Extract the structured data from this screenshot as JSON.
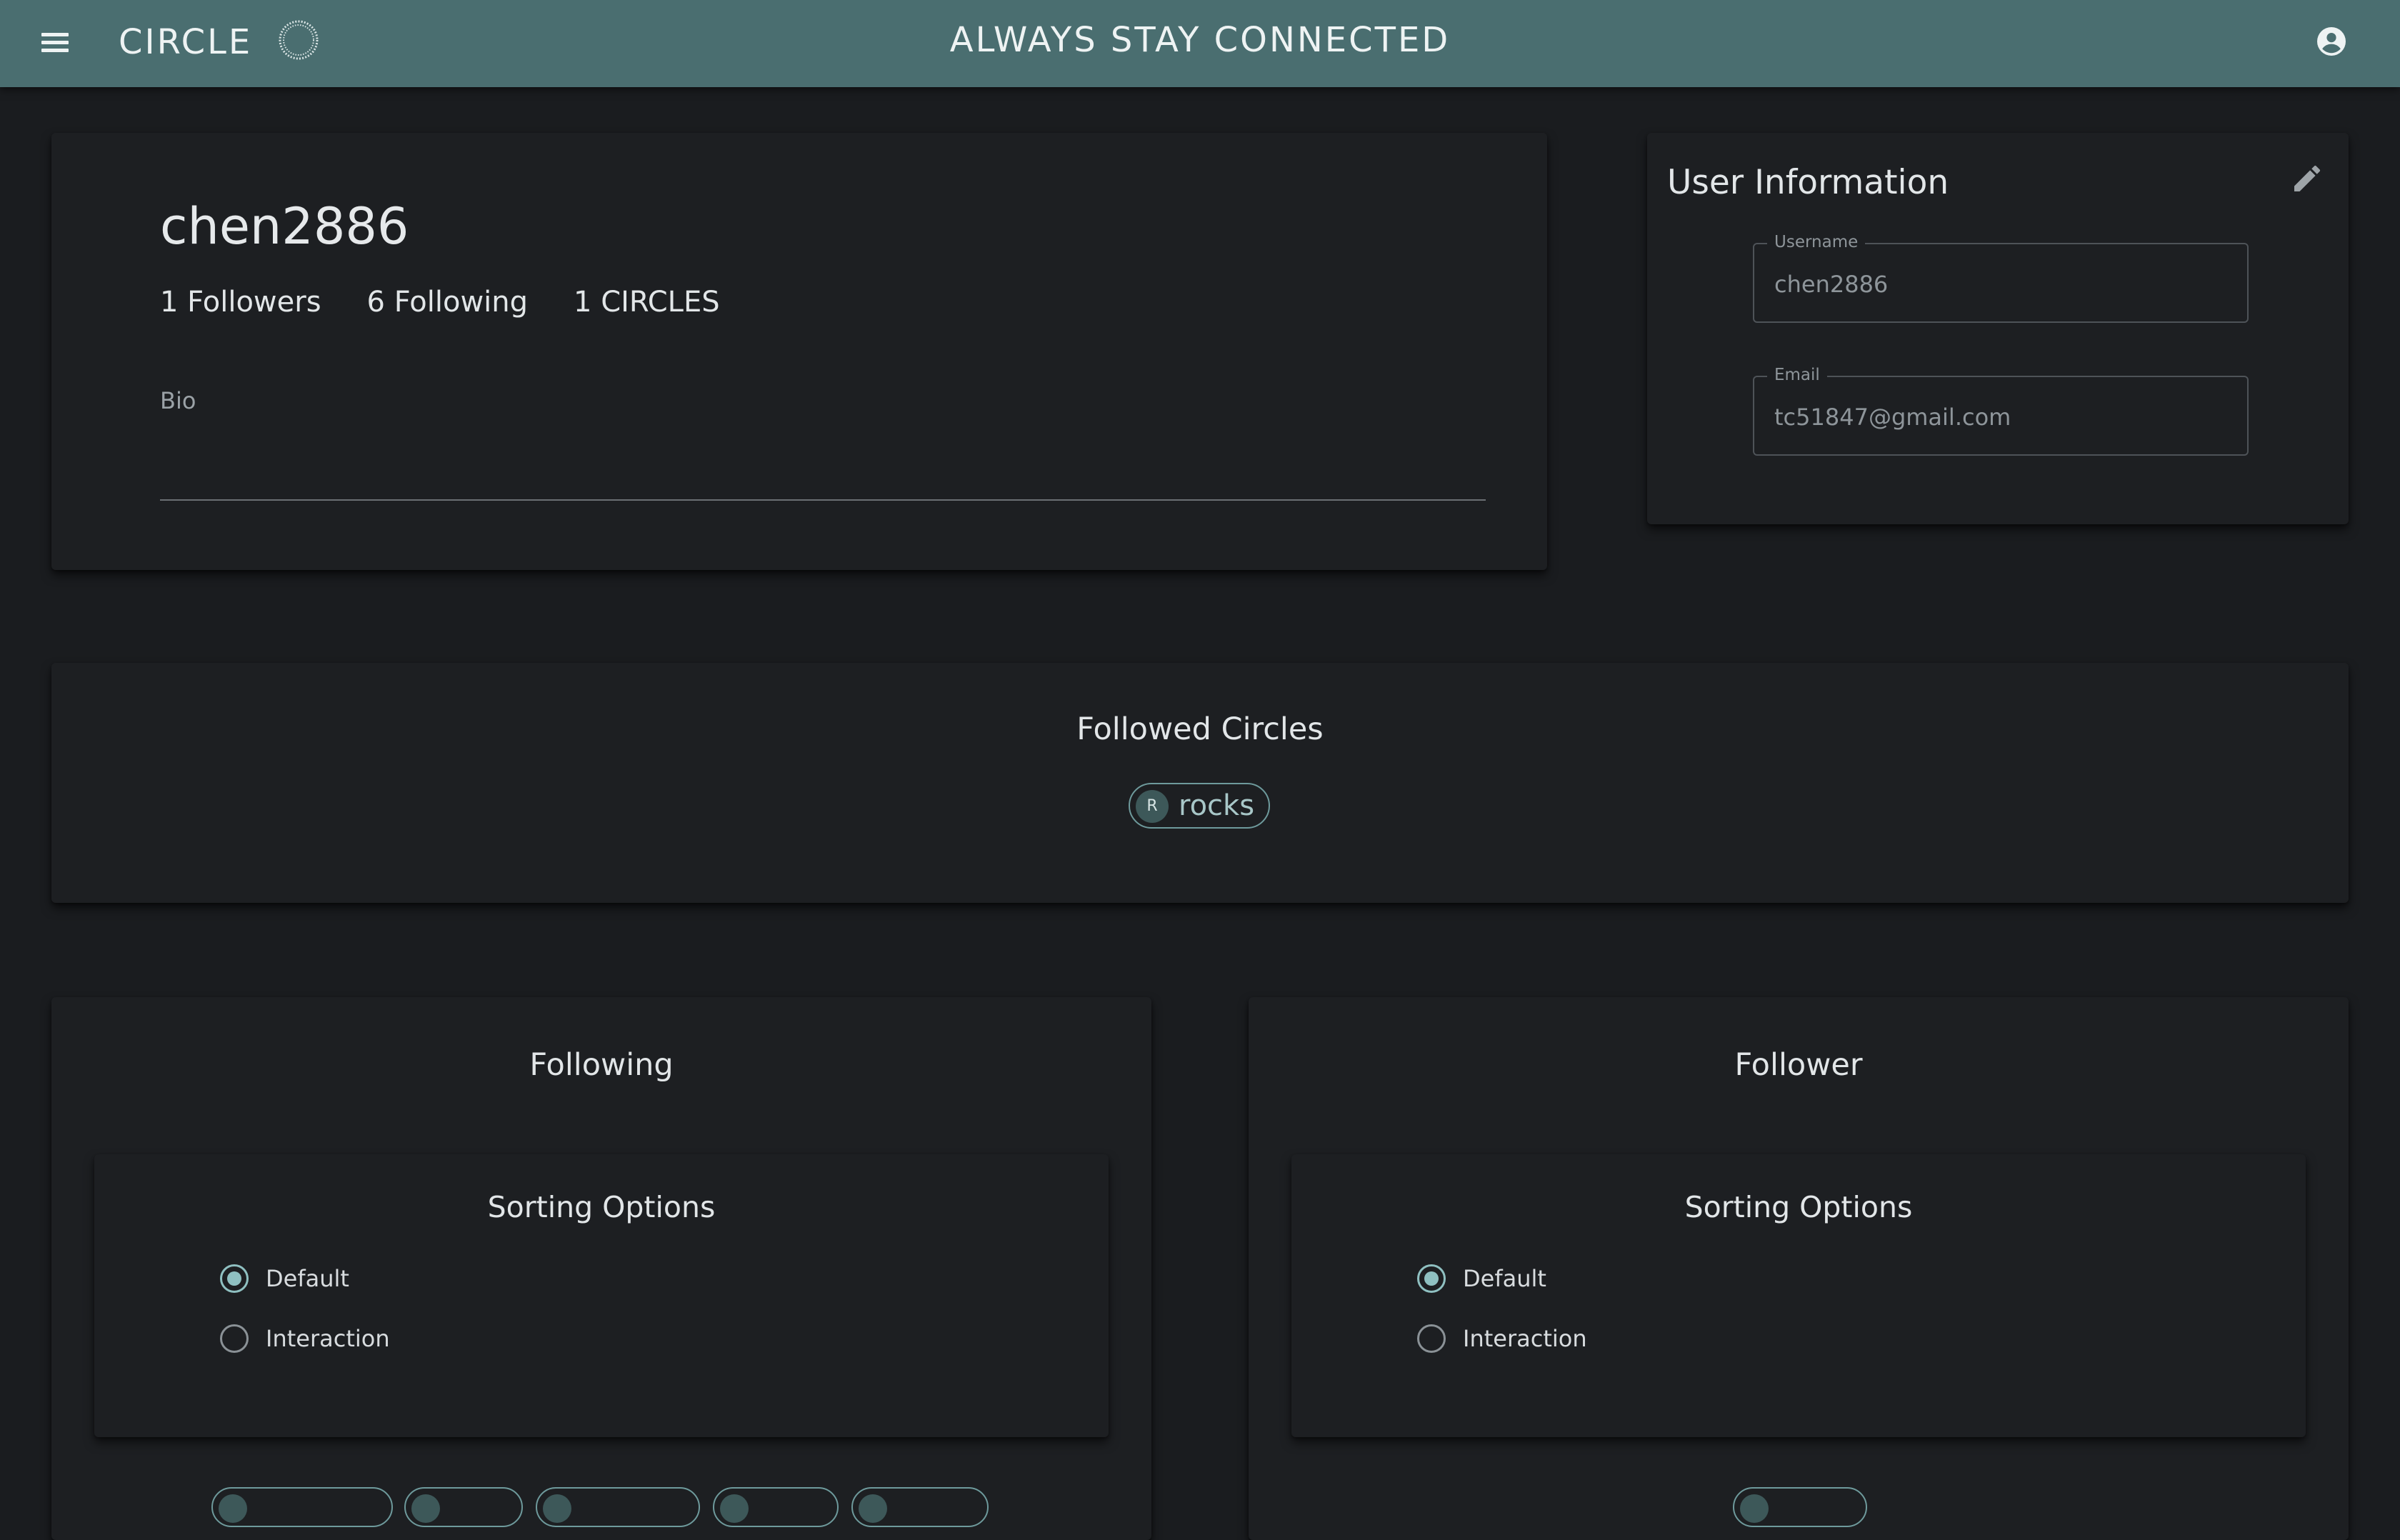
{
  "appbar": {
    "brand": "CIRCLE",
    "title": "ALWAYS STAY CONNECTED",
    "menu_icon": "menu-icon",
    "logo_icon": "circle-logo-icon",
    "account_icon": "account-circle-icon",
    "color": "#4a6e70"
  },
  "profile": {
    "username": "chen2886",
    "followers": "1 Followers",
    "following": "6 Following",
    "circles": "1 CIRCLES",
    "bio_label": "Bio",
    "bio_value": ""
  },
  "user_info": {
    "title": "User Information",
    "edit_icon": "pencil-icon",
    "username_label": "Username",
    "username_value": "chen2886",
    "email_label": "Email",
    "email_value": "tc51847@gmail.com"
  },
  "followed_circles": {
    "title": "Followed Circles",
    "items": [
      {
        "avatar": "R",
        "label": "rocks"
      }
    ]
  },
  "following_panel": {
    "title": "Following",
    "sort_title": "Sorting Options",
    "options": [
      "Default",
      "Interaction"
    ],
    "selected": "Default"
  },
  "follower_panel": {
    "title": "Follower",
    "sort_title": "Sorting Options",
    "options": [
      "Default",
      "Interaction"
    ],
    "selected": "Default"
  },
  "colors": {
    "background": "#1a1c1f",
    "card": "#1d1f22",
    "accent": "#8fc0c1"
  }
}
